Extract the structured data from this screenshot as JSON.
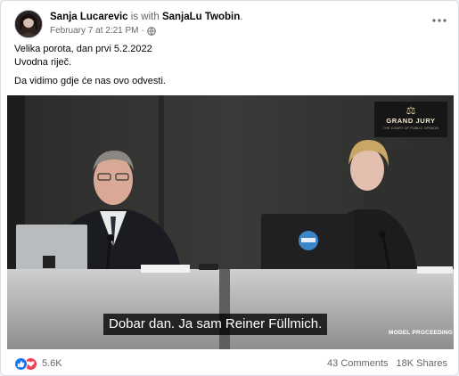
{
  "post": {
    "author": "Sanja Lucarevic",
    "with_text": "is with",
    "tagged": "SanjaLu Twobin",
    "period": ".",
    "date": "February 7 at 2:21 PM",
    "separator": "·",
    "audience_icon": "globe-icon",
    "more_icon": "more-options-icon",
    "text_lines": [
      "Velika porota, dan prvi 5.2.2022",
      "Uvodna riječ.",
      "Da vidimo gdje će nas ovo odvesti."
    ]
  },
  "video": {
    "logo_title": "GRAND JURY",
    "logo_subtitle": "THE COURT OF PUBLIC OPINION",
    "logo_icon": "scales-icon",
    "subtitle": "Dobar dan. Ja sam Reiner Füllmich.",
    "watermark": "MODEL PROCEEDING"
  },
  "stats": {
    "reactions_count": "5.6K",
    "reaction_icons": [
      "like-icon",
      "love-icon"
    ],
    "comments": "43 Comments",
    "shares": "18K Shares"
  },
  "colors": {
    "like": "#1877f2",
    "love": "#f33e58",
    "secondary_text": "#65676b"
  }
}
